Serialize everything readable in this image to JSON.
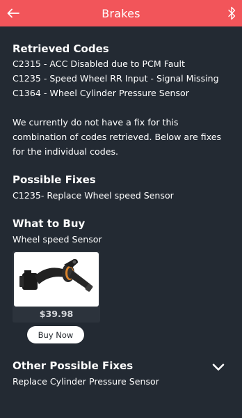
{
  "header": {
    "title": "Brakes",
    "back_icon": "arrow-left-icon",
    "bluetooth_icon": "bluetooth-icon",
    "background": "#f2555a"
  },
  "retrieved_codes": {
    "heading": "Retrieved Codes",
    "items": [
      "C2315 - ACC Disabled due to PCM Fault",
      "C1235 - Speed Wheel RR Input - Signal Missing",
      "C1364 - Wheel Cylinder Pressure Sensor"
    ]
  },
  "notice": {
    "lines": [
      "We currently do not have a fix for this",
      "combination of codes retrieved. Below are fixes",
      "for the individual codes."
    ]
  },
  "possible_fixes": {
    "heading": "Possible Fixes",
    "items": [
      "C1235- Replace Wheel speed Sensor"
    ]
  },
  "what_to_buy": {
    "heading": "What to Buy",
    "item_name": "Wheel speed Sensor",
    "price": "$39.98",
    "buy_label": "Buy Now"
  },
  "other_fixes": {
    "heading": "Other Possible Fixes",
    "item": "Replace Cylinder Pressure Sensor",
    "toggle_icon": "chevron-down-icon"
  },
  "colors": {
    "background": "#232a33",
    "accent": "#f2555a",
    "text": "#ffffff"
  }
}
